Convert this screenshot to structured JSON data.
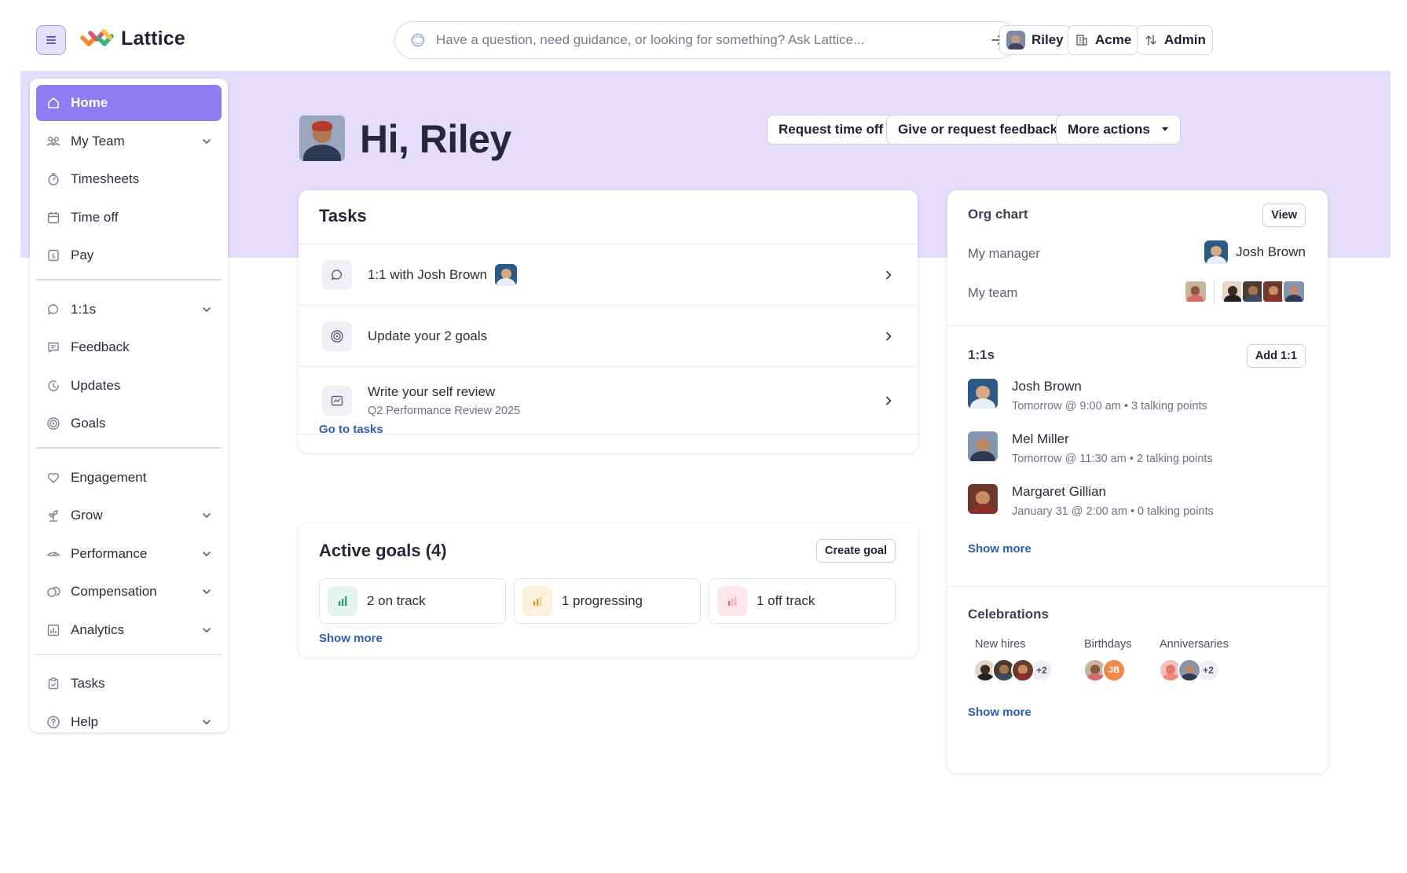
{
  "app": {
    "name": "Lattice"
  },
  "search": {
    "placeholder": "Have a question, need guidance, or looking for something? Ask Lattice..."
  },
  "top_buttons": {
    "user": "Riley",
    "company": "Acme",
    "admin": "Admin"
  },
  "sidebar": {
    "items": [
      {
        "label": "Home",
        "icon": "home-icon",
        "active": true,
        "expandable": false
      },
      {
        "label": "My Team",
        "icon": "team-icon",
        "expandable": true
      },
      {
        "label": "Timesheets",
        "icon": "stopwatch-icon",
        "expandable": false
      },
      {
        "label": "Time off",
        "icon": "calendar-icon",
        "expandable": false
      },
      {
        "label": "Pay",
        "icon": "dollar-icon",
        "expandable": false
      },
      {
        "label": "1:1s",
        "icon": "chat-icon",
        "expandable": true
      },
      {
        "label": "Feedback",
        "icon": "message-icon",
        "expandable": false
      },
      {
        "label": "Updates",
        "icon": "updates-icon",
        "expandable": false
      },
      {
        "label": "Goals",
        "icon": "target-icon",
        "expandable": false
      },
      {
        "label": "Engagement",
        "icon": "heart-icon",
        "expandable": false
      },
      {
        "label": "Grow",
        "icon": "plant-icon",
        "expandable": true
      },
      {
        "label": "Performance",
        "icon": "performance-icon",
        "expandable": true
      },
      {
        "label": "Compensation",
        "icon": "coins-icon",
        "expandable": true
      },
      {
        "label": "Analytics",
        "icon": "bar-chart-icon",
        "expandable": true
      },
      {
        "label": "Tasks",
        "icon": "clipboard-icon",
        "expandable": false
      },
      {
        "label": "Help",
        "icon": "help-icon",
        "expandable": true
      }
    ]
  },
  "greeting": {
    "text": "Hi, Riley"
  },
  "header_actions": {
    "request_time_off": "Request time off",
    "feedback": "Give or request feedback",
    "more_actions": "More actions"
  },
  "tasks": {
    "title": "Tasks",
    "items": [
      {
        "title": "1:1 with Josh Brown",
        "subtitle": "",
        "icon": "chat-icon"
      },
      {
        "title": "Update your 2 goals",
        "subtitle": "",
        "icon": "target-icon"
      },
      {
        "title": "Write your self review",
        "subtitle": "Q2 Performance Review 2025",
        "icon": "review-icon"
      }
    ],
    "link": "Go to tasks"
  },
  "goals": {
    "title": "Active goals (4)",
    "create_label": "Create goal",
    "statuses": [
      {
        "label": "2 on track",
        "color": "#2f9e7a",
        "bg": "#e3f5ee"
      },
      {
        "label": "1 progressing",
        "color": "#e39b2a",
        "bg": "#fdf0dc"
      },
      {
        "label": "1 off track",
        "color": "#e0677a",
        "bg": "#fde7ea"
      }
    ],
    "show_more": "Show more"
  },
  "org_chart": {
    "title": "Org chart",
    "view_label": "View",
    "manager_label": "My manager",
    "manager_name": "Josh Brown",
    "team_label": "My team"
  },
  "one_on_ones": {
    "title": "1:1s",
    "add_label": "Add 1:1",
    "items": [
      {
        "name": "Josh Brown",
        "detail": "Tomorrow @ 9:00 am • 3 talking points"
      },
      {
        "name": "Mel Miller",
        "detail": "Tomorrow @ 11:30 am • 2 talking points"
      },
      {
        "name": "Margaret Gillian",
        "detail": "January 31 @ 2:00 am • 0 talking points"
      }
    ],
    "show_more": "Show more"
  },
  "celebrations": {
    "title": "Celebrations",
    "new_hires_label": "New hires",
    "new_hires_more": "+2",
    "birthdays_label": "Birthdays",
    "birthday_initials": "JB",
    "anniversaries_label": "Anniversaries",
    "anniversaries_more": "+2",
    "show_more": "Show more"
  },
  "colors": {
    "accent": "#8f7cf0",
    "hero_bg": "#e6dcfb",
    "link": "#2e5fb8"
  }
}
